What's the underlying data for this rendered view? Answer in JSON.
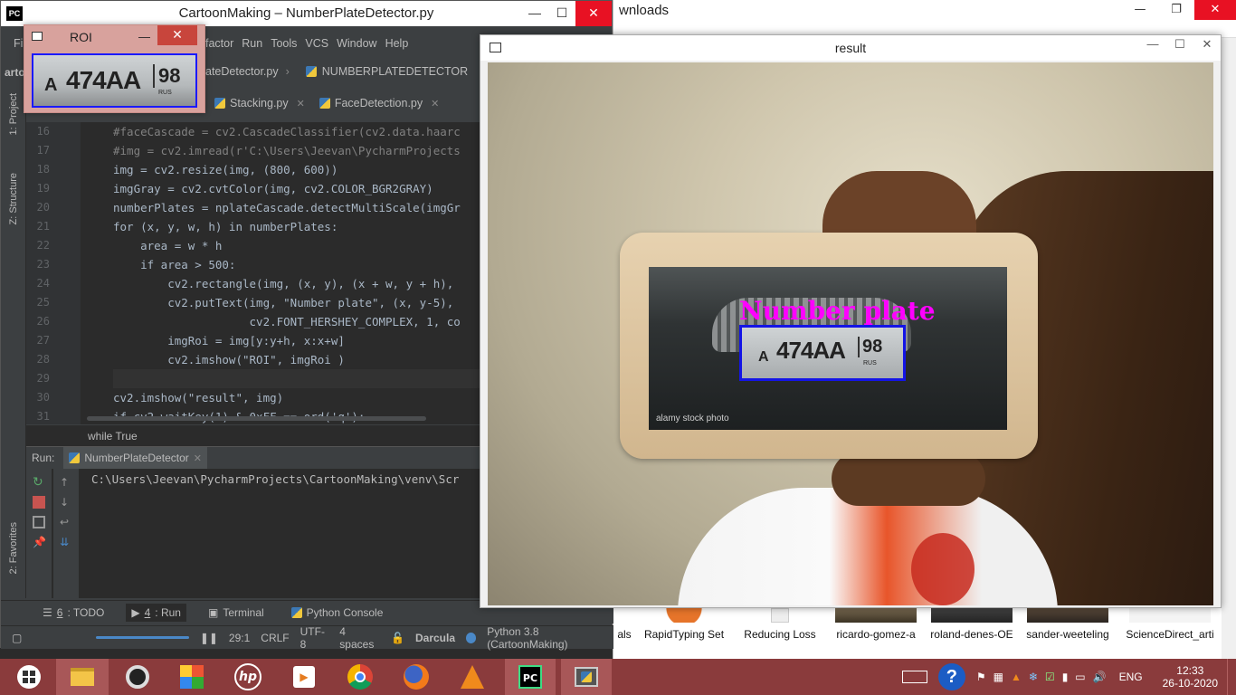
{
  "pycharm": {
    "title": "CartoonMaking – NumberPlateDetector.py",
    "logo": "PC",
    "menu_partial_left": "Fil",
    "menu": [
      "factor",
      "Run",
      "Tools",
      "VCS",
      "Window",
      "Help"
    ],
    "project_partial": "arto",
    "nav_file": "ateDetector.py",
    "run_config": "NUMBERPLATEDETECTOR",
    "tabs": [
      {
        "label": "Stacking.py"
      },
      {
        "label": "FaceDetection.py"
      }
    ],
    "side_labels": {
      "project": "1: Project",
      "structure": "Z: Structure",
      "favorites": "2: Favorites"
    },
    "line_numbers": [
      "16",
      "17",
      "18",
      "19",
      "20",
      "21",
      "22",
      "23",
      "24",
      "25",
      "26",
      "27",
      "28",
      "29",
      "30",
      "31"
    ],
    "code_lines": [
      "#faceCascade = cv2.CascadeClassifier(cv2.data.haarc",
      "#img = cv2.imread(r'C:\\Users\\Jeevan\\PycharmProjects",
      "img = cv2.resize(img, (800, 600))",
      "imgGray = cv2.cvtColor(img, cv2.COLOR_BGR2GRAY)",
      "numberPlates = nplateCascade.detectMultiScale(imgGr",
      "for (x, y, w, h) in numberPlates:",
      "    area = w * h",
      "    if area > 500:",
      "        cv2.rectangle(img, (x, y), (x + w, y + h),",
      "        cv2.putText(img, \"Number plate\", (x, y-5),",
      "                    cv2.FONT_HERSHEY_COMPLEX, 1, co",
      "        imgRoi = img[y:y+h, x:x+w]",
      "        cv2.imshow(\"ROI\", imgRoi )",
      "",
      "cv2.imshow(\"result\", img)",
      "if cv2.waitKey(1) & 0xFF == ord('q'):"
    ],
    "breadcrumb": "while True",
    "run_label": "Run:",
    "run_tab": "NumberPlateDetector",
    "console_line": "C:\\Users\\Jeevan\\PycharmProjects\\CartoonMaking\\venv\\Scr",
    "bottom_tabs": [
      {
        "num": "6",
        "label": ": TODO"
      },
      {
        "num": "4",
        "label": ": Run"
      },
      {
        "num": "",
        "label": "Terminal"
      },
      {
        "num": "",
        "label": "Python Console"
      }
    ],
    "status": {
      "pos": "29:1",
      "eol": "CRLF",
      "enc": "UTF-8",
      "indent": "4 spaces",
      "theme": "Darcula",
      "interp": "Python 3.8 (CartoonMaking)"
    }
  },
  "roi_window": {
    "title": "ROI",
    "plate_left": "A",
    "plate_main": "474AA",
    "plate_region": "98",
    "plate_country": "RUS"
  },
  "result_window": {
    "title": "result",
    "label_text": "Number plate",
    "plate_left": "A",
    "plate_main": "474AA",
    "plate_region": "98",
    "plate_country": "RUS",
    "watermark": "alamy stock photo",
    "colors": {
      "box": "#1414e6",
      "label": "#ff00ff"
    }
  },
  "explorer": {
    "title_partial": "wnloads",
    "thumbnails": [
      "als",
      "RapidTyping Set",
      "Reducing Loss",
      "ricardo-gomez-a",
      "roland-denes-OE",
      "sander-weeteling",
      "ScienceDirect_arti"
    ]
  },
  "taskbar": {
    "lang": "ENG",
    "time": "12:33",
    "date": "26-10-2020",
    "apps": [
      "start",
      "file-explorer",
      "webcam",
      "paint-3d",
      "hp",
      "video-editor",
      "chrome",
      "firefox",
      "vlc",
      "pycharm",
      "python"
    ]
  }
}
